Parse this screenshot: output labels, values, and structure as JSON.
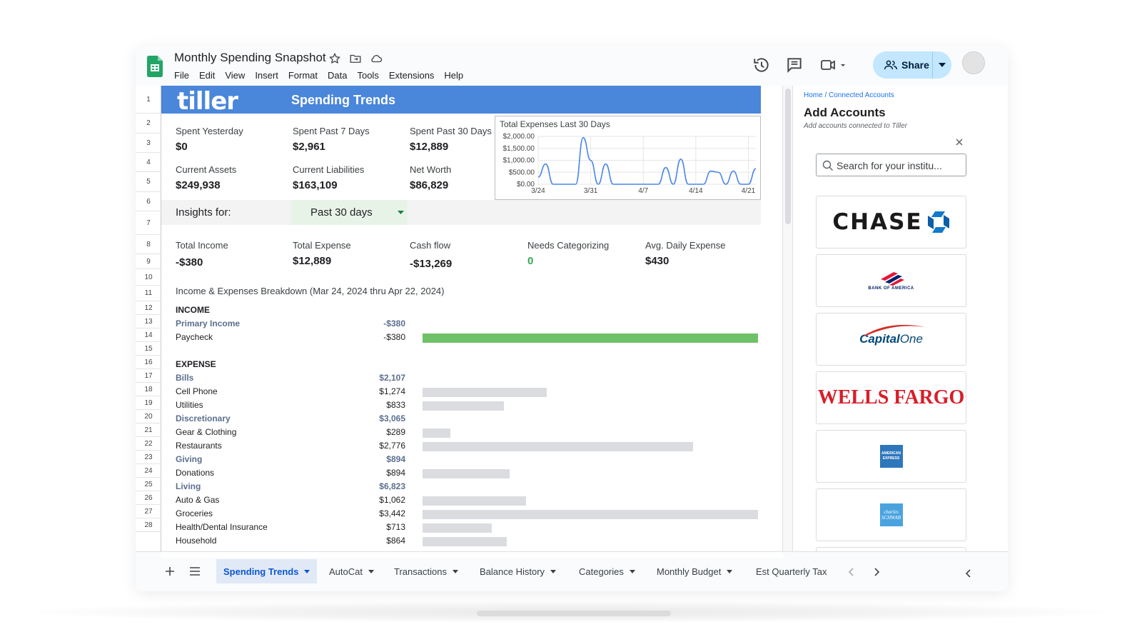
{
  "app": {
    "doc_title": "Monthly Spending Snapshot",
    "menu": [
      "File",
      "Edit",
      "View",
      "Insert",
      "Format",
      "Data",
      "Tools",
      "Extensions",
      "Help"
    ],
    "share_label": "Share"
  },
  "rows": [
    "1",
    "2",
    "3",
    "4",
    "5",
    "6",
    "7",
    "8",
    "9",
    "10",
    "11",
    "12",
    "13",
    "14",
    "15",
    "16",
    "17",
    "18",
    "19",
    "20",
    "21",
    "22",
    "23",
    "24",
    "25",
    "26",
    "27",
    "28"
  ],
  "banner": {
    "logo": "tiller",
    "title": "Spending Trends"
  },
  "summary": {
    "spent_yesterday": {
      "label": "Spent Yesterday",
      "value": "$0"
    },
    "spent_7": {
      "label": "Spent Past 7 Days",
      "value": "$2,961"
    },
    "spent_30": {
      "label": "Spent Past 30 Days",
      "value": "$12,889"
    },
    "assets": {
      "label": "Current Assets",
      "value": "$249,938"
    },
    "liabilities": {
      "label": "Current Liabilities",
      "value": "$163,109"
    },
    "net_worth": {
      "label": "Net Worth",
      "value": "$86,829"
    }
  },
  "insights": {
    "label": "Insights for:",
    "period": "Past 30 days"
  },
  "kpis": {
    "income": {
      "label": "Total Income",
      "value": "-$380"
    },
    "expense": {
      "label": "Total Expense",
      "value": "$12,889"
    },
    "cashflow": {
      "label": "Cash flow",
      "value": "-$13,269"
    },
    "needs_cat": {
      "label": "Needs Categorizing",
      "value": "0"
    },
    "avg_daily": {
      "label": "Avg. Daily Expense",
      "value": "$430"
    }
  },
  "breakdown_title": "Income & Expenses Breakdown (Mar 24, 2024 thru Apr 22, 2024)",
  "breakdown": [
    {
      "label": "INCOME",
      "kind": "head",
      "value": "",
      "bar": 0
    },
    {
      "label": "Primary Income",
      "kind": "cat",
      "value": "-$380",
      "bar": 0
    },
    {
      "label": "Paycheck",
      "kind": "item",
      "value": "-$380",
      "bar": 1.0,
      "green": true
    },
    {
      "label": "",
      "kind": "blank",
      "value": "",
      "bar": 0
    },
    {
      "label": "EXPENSE",
      "kind": "head",
      "value": "",
      "bar": 0
    },
    {
      "label": "Bills",
      "kind": "cat",
      "value": "$2,107",
      "bar": 0
    },
    {
      "label": "Cell Phone",
      "kind": "item",
      "value": "$1,274",
      "bar": 0.37
    },
    {
      "label": "Utilities",
      "kind": "item",
      "value": "$833",
      "bar": 0.242
    },
    {
      "label": "Discretionary",
      "kind": "cat",
      "value": "$3,065",
      "bar": 0
    },
    {
      "label": "Gear & Clothing",
      "kind": "item",
      "value": "$289",
      "bar": 0.084
    },
    {
      "label": "Restaurants",
      "kind": "item",
      "value": "$2,776",
      "bar": 0.806
    },
    {
      "label": "Giving",
      "kind": "cat",
      "value": "$894",
      "bar": 0
    },
    {
      "label": "Donations",
      "kind": "item",
      "value": "$894",
      "bar": 0.26
    },
    {
      "label": "Living",
      "kind": "cat",
      "value": "$6,823",
      "bar": 0
    },
    {
      "label": "Auto & Gas",
      "kind": "item",
      "value": "$1,062",
      "bar": 0.309
    },
    {
      "label": "Groceries",
      "kind": "item",
      "value": "$3,442",
      "bar": 1.0
    },
    {
      "label": "Health/Dental Insurance",
      "kind": "item",
      "value": "$713",
      "bar": 0.207
    },
    {
      "label": "Household",
      "kind": "item",
      "value": "$864",
      "bar": 0.251
    }
  ],
  "chart_data": {
    "type": "line",
    "title": "Total Expenses Last 30 Days",
    "x_ticks": [
      "3/24",
      "3/31",
      "4/7",
      "4/14",
      "4/21"
    ],
    "y_ticks": [
      "$2,000.00",
      "$1,500.00",
      "$1,000.00",
      "$500.00",
      "$0.00"
    ],
    "ylim": [
      0,
      2000
    ],
    "x": [
      "3/24",
      "3/25",
      "3/26",
      "3/27",
      "3/28",
      "3/29",
      "3/30",
      "3/31",
      "4/1",
      "4/2",
      "4/3",
      "4/4",
      "4/5",
      "4/6",
      "4/7",
      "4/8",
      "4/9",
      "4/10",
      "4/11",
      "4/12",
      "4/13",
      "4/14",
      "4/15",
      "4/16",
      "4/17",
      "4/18",
      "4/19",
      "4/20",
      "4/21",
      "4/22"
    ],
    "values": [
      300,
      850,
      0,
      0,
      0,
      0,
      1950,
      1000,
      0,
      850,
      0,
      0,
      0,
      0,
      0,
      0,
      0,
      700,
      0,
      1050,
      0,
      0,
      0,
      550,
      500,
      0,
      550,
      0,
      0,
      650
    ],
    "series_color": "#4a86e8",
    "grid": true
  },
  "panel": {
    "breadcrumb": "Home / Connected Accounts",
    "title": "Add Accounts",
    "subtitle": "Add accounts connected to Tiller",
    "search_placeholder": "Search for your institu...",
    "institutions": {
      "chase": "CHASE",
      "boa": "BANK OF AMERICA",
      "capone_a": "Capital",
      "capone_b": "One",
      "wells": "WELLS FARGO",
      "amex": "AMERICAN EXPRESS",
      "schwab": "charles SCHWAB"
    }
  },
  "tabs": [
    "Spending Trends",
    "AutoCat",
    "Transactions",
    "Balance History",
    "Categories",
    "Monthly Budget",
    "Est Quarterly Tax"
  ],
  "colors": {
    "banner": "#4a86da",
    "accent_blue": "#0b57d0",
    "share_bg": "#c2e7ff",
    "green_bar": "#6fc167",
    "gray_bar": "#dadce0",
    "needs_cat_green": "#34a853"
  }
}
